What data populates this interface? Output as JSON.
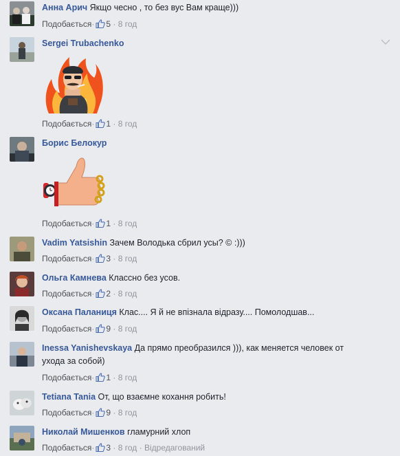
{
  "like_label": "Подобається",
  "dot": "·",
  "colors": {
    "name": "#365899",
    "meta": "#90949c",
    "bg": "#eaebef"
  },
  "comments": [
    {
      "name": "Анна Арич",
      "text": "Якщо чесно , то без вус Вам краще)))",
      "likes": "5",
      "time": "8 год"
    },
    {
      "name": "Sergei Trubachenko",
      "text": "",
      "likes": "1",
      "time": "8 год",
      "sticker": "angry-biker-fire-sticker"
    },
    {
      "name": "Борис Белокур",
      "text": "",
      "likes": "1",
      "time": "8 год",
      "sticker": "thumbs-up-sticker"
    },
    {
      "name": "Vadim Yatsishin",
      "text": "Зачем Володька сбрил усы? © :)))",
      "likes": "3",
      "time": "8 год"
    },
    {
      "name": "Ольга Камнева",
      "text": "Классно без усов.",
      "likes": "2",
      "time": "8 год"
    },
    {
      "name": "Оксана Паланиця",
      "text": "Клас.... Я й не впізнала відразу.... Помолодшав...",
      "likes": "9",
      "time": "8 год"
    },
    {
      "name": "Inessa Yanishevskaya",
      "text": "Да прямо преобразился ))), как меняется человек от",
      "text2": "ухода за собой)",
      "likes": "1",
      "time": "8 год"
    },
    {
      "name": "Tetiana Tania",
      "text": "От, що взаємне кохання робить!",
      "likes": "9",
      "time": "8 год"
    },
    {
      "name": "Николай Мишенков",
      "text": "гламурний хлоп",
      "likes": "3",
      "time": "8 год",
      "edited": "Відредагований"
    }
  ]
}
